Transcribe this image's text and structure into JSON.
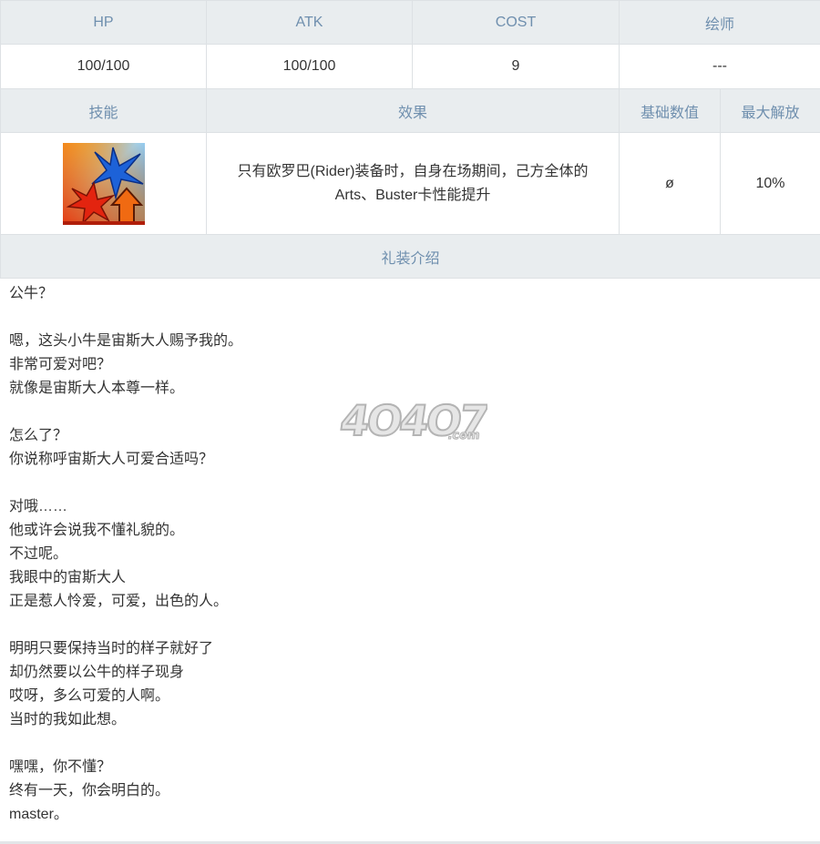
{
  "stats_header": [
    "HP",
    "ATK",
    "COST",
    "绘师"
  ],
  "stats_values": [
    "100/100",
    "100/100",
    "9",
    "---"
  ],
  "skill_header": [
    "技能",
    "效果",
    "基础数值",
    "最大解放"
  ],
  "skill": {
    "icon": "arts-buster-up-skill-icon",
    "effect": "只有欧罗巴(Rider)装备时，自身在场期间，己方全体的Arts、Buster卡性能提升",
    "base_value": "ø",
    "max_value": "10%"
  },
  "intro": {
    "title": "礼装介绍",
    "lines": [
      "公牛？",
      "",
      "嗯，这头小牛是宙斯大人赐予我的。",
      "非常可爱对吧？",
      "就像是宙斯大人本尊一样。",
      "",
      "怎么了？",
      "你说称呼宙斯大人可爱合适吗？",
      "",
      "对哦……",
      "他或许会说我不懂礼貌的。",
      "不过呢。",
      "我眼中的宙斯大人",
      "正是惹人怜爱，可爱，出色的人。",
      "",
      "明明只要保持当时的样子就好了",
      "却仍然要以公牛的样子现身",
      "哎呀，多么可爱的人啊。",
      "当时的我如此想。",
      "",
      "嘿嘿，你不懂？",
      "终有一天，你会明白的。",
      "master。"
    ]
  },
  "watermark": "4O4O7.com",
  "colors": {
    "header_bg": "#e9edef",
    "header_text": "#6f8fae",
    "border": "#dde1e4",
    "text": "#333333"
  }
}
